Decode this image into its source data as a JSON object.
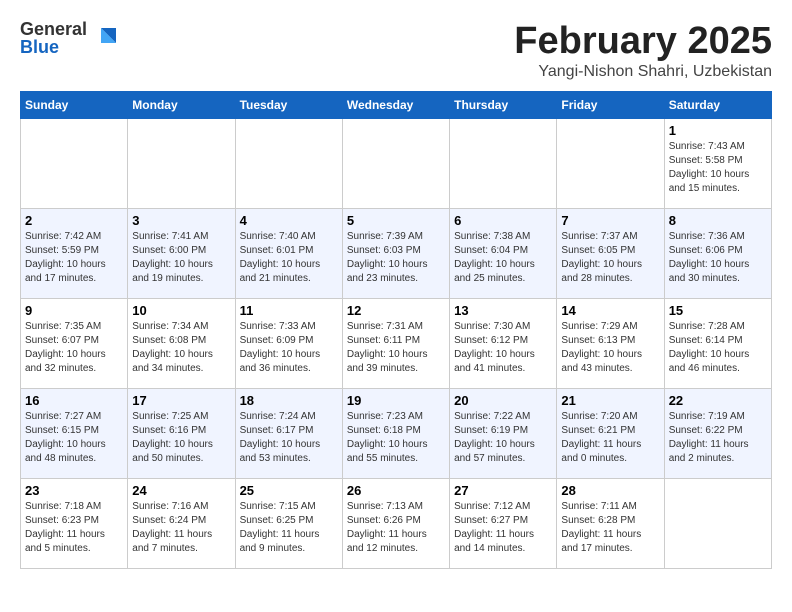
{
  "header": {
    "logo_general": "General",
    "logo_blue": "Blue",
    "title": "February 2025",
    "subtitle": "Yangi-Nishon Shahri, Uzbekistan"
  },
  "weekdays": [
    "Sunday",
    "Monday",
    "Tuesday",
    "Wednesday",
    "Thursday",
    "Friday",
    "Saturday"
  ],
  "weeks": [
    [
      {
        "day": "",
        "info": ""
      },
      {
        "day": "",
        "info": ""
      },
      {
        "day": "",
        "info": ""
      },
      {
        "day": "",
        "info": ""
      },
      {
        "day": "",
        "info": ""
      },
      {
        "day": "",
        "info": ""
      },
      {
        "day": "1",
        "info": "Sunrise: 7:43 AM\nSunset: 5:58 PM\nDaylight: 10 hours\nand 15 minutes."
      }
    ],
    [
      {
        "day": "2",
        "info": "Sunrise: 7:42 AM\nSunset: 5:59 PM\nDaylight: 10 hours\nand 17 minutes."
      },
      {
        "day": "3",
        "info": "Sunrise: 7:41 AM\nSunset: 6:00 PM\nDaylight: 10 hours\nand 19 minutes."
      },
      {
        "day": "4",
        "info": "Sunrise: 7:40 AM\nSunset: 6:01 PM\nDaylight: 10 hours\nand 21 minutes."
      },
      {
        "day": "5",
        "info": "Sunrise: 7:39 AM\nSunset: 6:03 PM\nDaylight: 10 hours\nand 23 minutes."
      },
      {
        "day": "6",
        "info": "Sunrise: 7:38 AM\nSunset: 6:04 PM\nDaylight: 10 hours\nand 25 minutes."
      },
      {
        "day": "7",
        "info": "Sunrise: 7:37 AM\nSunset: 6:05 PM\nDaylight: 10 hours\nand 28 minutes."
      },
      {
        "day": "8",
        "info": "Sunrise: 7:36 AM\nSunset: 6:06 PM\nDaylight: 10 hours\nand 30 minutes."
      }
    ],
    [
      {
        "day": "9",
        "info": "Sunrise: 7:35 AM\nSunset: 6:07 PM\nDaylight: 10 hours\nand 32 minutes."
      },
      {
        "day": "10",
        "info": "Sunrise: 7:34 AM\nSunset: 6:08 PM\nDaylight: 10 hours\nand 34 minutes."
      },
      {
        "day": "11",
        "info": "Sunrise: 7:33 AM\nSunset: 6:09 PM\nDaylight: 10 hours\nand 36 minutes."
      },
      {
        "day": "12",
        "info": "Sunrise: 7:31 AM\nSunset: 6:11 PM\nDaylight: 10 hours\nand 39 minutes."
      },
      {
        "day": "13",
        "info": "Sunrise: 7:30 AM\nSunset: 6:12 PM\nDaylight: 10 hours\nand 41 minutes."
      },
      {
        "day": "14",
        "info": "Sunrise: 7:29 AM\nSunset: 6:13 PM\nDaylight: 10 hours\nand 43 minutes."
      },
      {
        "day": "15",
        "info": "Sunrise: 7:28 AM\nSunset: 6:14 PM\nDaylight: 10 hours\nand 46 minutes."
      }
    ],
    [
      {
        "day": "16",
        "info": "Sunrise: 7:27 AM\nSunset: 6:15 PM\nDaylight: 10 hours\nand 48 minutes."
      },
      {
        "day": "17",
        "info": "Sunrise: 7:25 AM\nSunset: 6:16 PM\nDaylight: 10 hours\nand 50 minutes."
      },
      {
        "day": "18",
        "info": "Sunrise: 7:24 AM\nSunset: 6:17 PM\nDaylight: 10 hours\nand 53 minutes."
      },
      {
        "day": "19",
        "info": "Sunrise: 7:23 AM\nSunset: 6:18 PM\nDaylight: 10 hours\nand 55 minutes."
      },
      {
        "day": "20",
        "info": "Sunrise: 7:22 AM\nSunset: 6:19 PM\nDaylight: 10 hours\nand 57 minutes."
      },
      {
        "day": "21",
        "info": "Sunrise: 7:20 AM\nSunset: 6:21 PM\nDaylight: 11 hours\nand 0 minutes."
      },
      {
        "day": "22",
        "info": "Sunrise: 7:19 AM\nSunset: 6:22 PM\nDaylight: 11 hours\nand 2 minutes."
      }
    ],
    [
      {
        "day": "23",
        "info": "Sunrise: 7:18 AM\nSunset: 6:23 PM\nDaylight: 11 hours\nand 5 minutes."
      },
      {
        "day": "24",
        "info": "Sunrise: 7:16 AM\nSunset: 6:24 PM\nDaylight: 11 hours\nand 7 minutes."
      },
      {
        "day": "25",
        "info": "Sunrise: 7:15 AM\nSunset: 6:25 PM\nDaylight: 11 hours\nand 9 minutes."
      },
      {
        "day": "26",
        "info": "Sunrise: 7:13 AM\nSunset: 6:26 PM\nDaylight: 11 hours\nand 12 minutes."
      },
      {
        "day": "27",
        "info": "Sunrise: 7:12 AM\nSunset: 6:27 PM\nDaylight: 11 hours\nand 14 minutes."
      },
      {
        "day": "28",
        "info": "Sunrise: 7:11 AM\nSunset: 6:28 PM\nDaylight: 11 hours\nand 17 minutes."
      },
      {
        "day": "",
        "info": ""
      }
    ]
  ]
}
